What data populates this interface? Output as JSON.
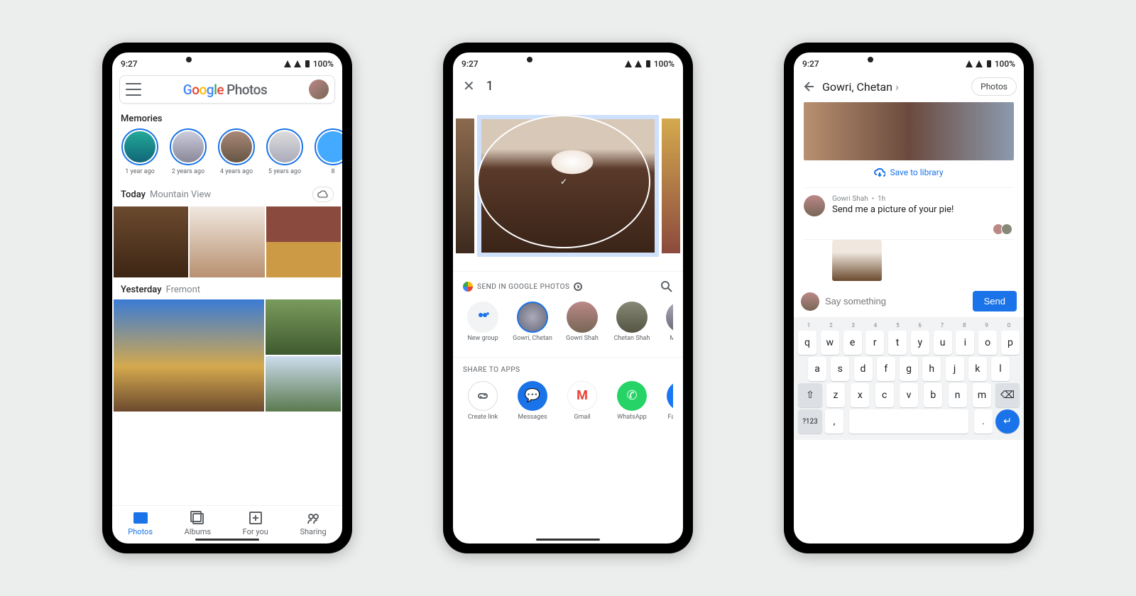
{
  "status": {
    "time": "9:27",
    "battery": "100%"
  },
  "phone1": {
    "app_title_main": "Google",
    "app_title_sub": "Photos",
    "memories_label": "Memories",
    "memories": [
      "1 year ago",
      "2 years ago",
      "4 years ago",
      "5 years ago",
      "8"
    ],
    "today": {
      "label": "Today",
      "location": "Mountain View"
    },
    "yesterday": {
      "label": "Yesterday",
      "location": "Fremont"
    },
    "tabs": [
      "Photos",
      "Albums",
      "For you",
      "Sharing"
    ]
  },
  "phone2": {
    "selected_count": "1",
    "send_label": "SEND IN GOOGLE PHOTOS",
    "contacts": [
      {
        "name": "New group"
      },
      {
        "name": "Gowri, Chetan"
      },
      {
        "name": "Gowri Shah"
      },
      {
        "name": "Chetan Shah"
      },
      {
        "name": "Mark Ch"
      }
    ],
    "share_apps_label": "SHARE TO APPS",
    "apps": [
      {
        "name": "Create link"
      },
      {
        "name": "Messages"
      },
      {
        "name": "Gmail"
      },
      {
        "name": "WhatsApp"
      },
      {
        "name": "Facebook"
      }
    ]
  },
  "phone3": {
    "chat_title": "Gowri, Chetan",
    "photos_button": "Photos",
    "save_library": "Save to library",
    "msg_sender": "Gowri Shah",
    "msg_time": "1h",
    "msg_text": "Send me a picture of your pie!",
    "composer_placeholder": "Say something",
    "send_label": "Send",
    "kbd": {
      "nums": [
        "1",
        "2",
        "3",
        "4",
        "5",
        "6",
        "7",
        "8",
        "9",
        "0"
      ],
      "r1": [
        "q",
        "w",
        "e",
        "r",
        "t",
        "y",
        "u",
        "i",
        "o",
        "p"
      ],
      "r2": [
        "a",
        "s",
        "d",
        "f",
        "g",
        "h",
        "j",
        "k",
        "l"
      ],
      "r3": [
        "z",
        "x",
        "c",
        "v",
        "b",
        "n",
        "m"
      ],
      "sym": "?123",
      "comma": ",",
      "period": "."
    }
  }
}
